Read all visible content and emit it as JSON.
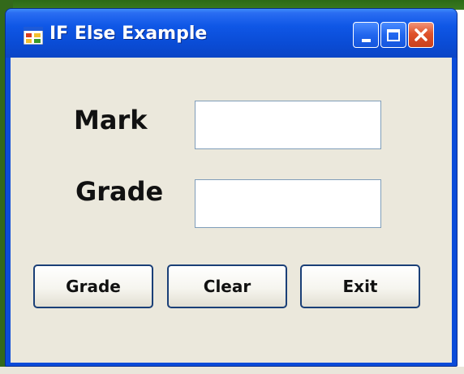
{
  "window": {
    "title": "IF Else Example",
    "app_icon": "windows-form-icon",
    "controls": {
      "minimize_icon": "minimize-icon",
      "maximize_icon": "maximize-icon",
      "close_icon": "close-icon"
    }
  },
  "form": {
    "mark_label": "Mark",
    "mark_value": "",
    "grade_label": "Grade",
    "grade_value": ""
  },
  "buttons": {
    "grade_label": "Grade",
    "clear_label": "Clear",
    "exit_label": "Exit"
  },
  "colors": {
    "titlebar": "#0b4bd9",
    "client_background": "#ebe8dc",
    "close_button": "#e0522b",
    "desktop": "#33691a"
  }
}
